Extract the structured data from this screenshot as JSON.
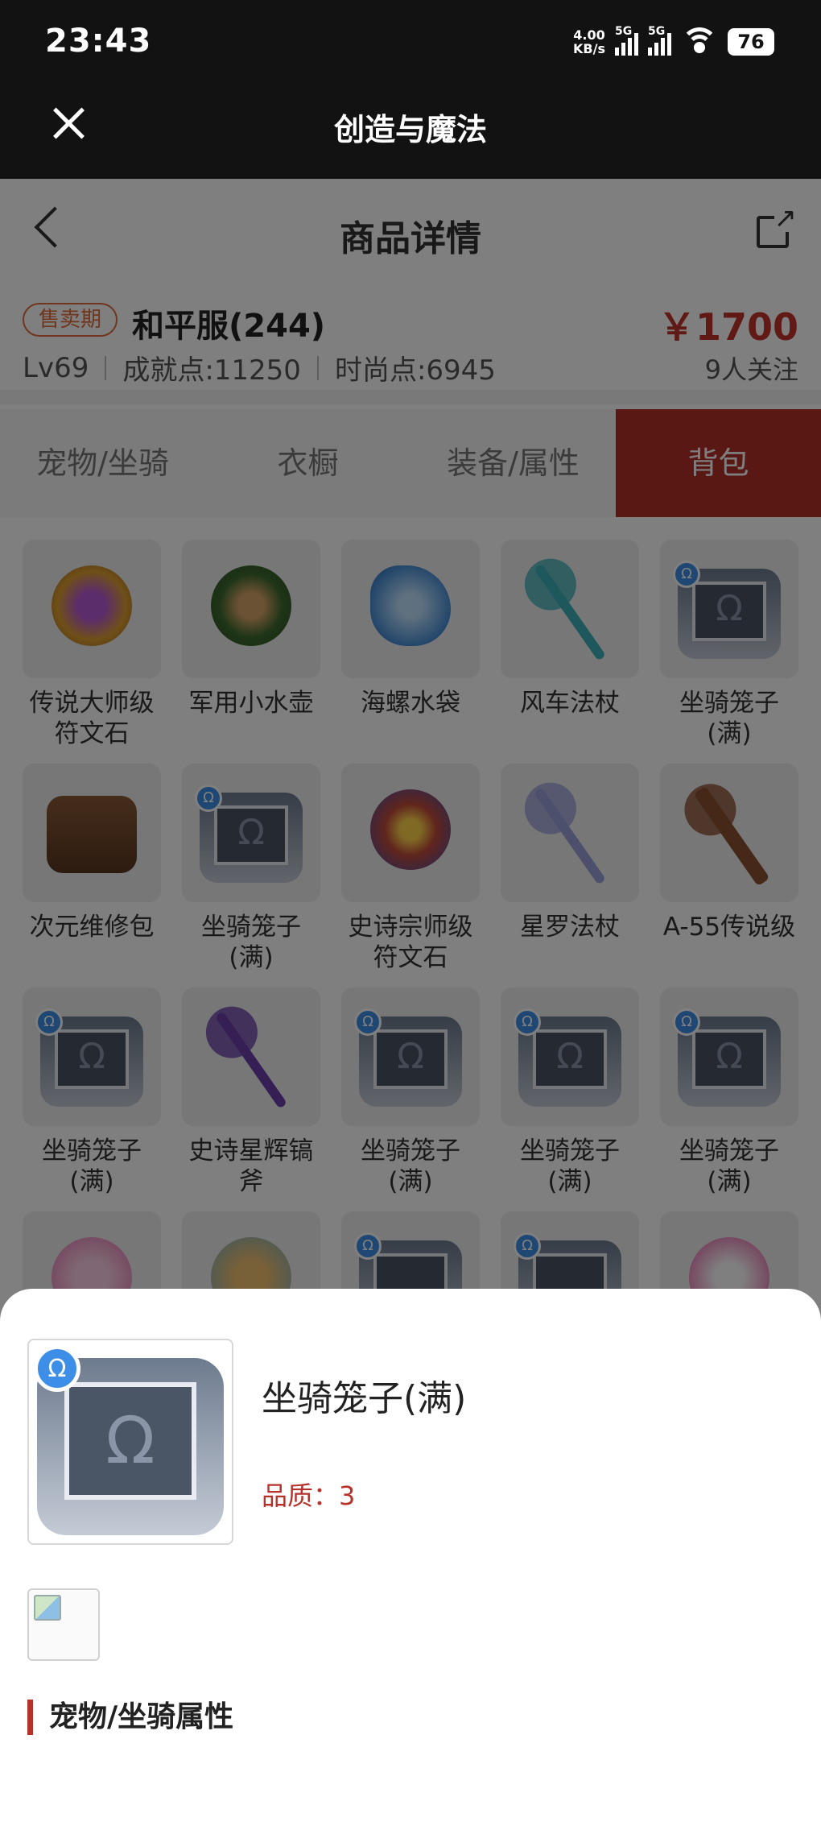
{
  "status_bar": {
    "time": "23:43",
    "speed_value": "4.00",
    "speed_unit": "KB/s",
    "signal1": "5G",
    "signal2": "5G",
    "battery": "76"
  },
  "app_bar": {
    "title": "创造与魔法"
  },
  "nav": {
    "title": "商品详情"
  },
  "listing": {
    "tag": "售卖期",
    "server": "和平服(244)",
    "price": "￥1700",
    "level": "Lv69",
    "achievement": "成就点:11250",
    "fashion": "时尚点:6945",
    "followers": "9人关注"
  },
  "tabs": [
    {
      "label": "宠物/坐骑"
    },
    {
      "label": "衣橱"
    },
    {
      "label": "装备/属性"
    },
    {
      "label": "背包",
      "active": true
    }
  ],
  "items": [
    {
      "name": "传说大师级符文石",
      "icon": "rune-stone-icon"
    },
    {
      "name": "军用小水壶",
      "icon": "canteen-icon"
    },
    {
      "name": "海螺水袋",
      "icon": "conch-icon"
    },
    {
      "name": "风车法杖",
      "icon": "pinwheel-staff-icon"
    },
    {
      "name": "坐骑笼子(满)",
      "icon": "mount-cage-icon"
    },
    {
      "name": "次元维修包",
      "icon": "repair-kit-icon"
    },
    {
      "name": "坐骑笼子(满)",
      "icon": "mount-cage-icon"
    },
    {
      "name": "史诗宗师级符文石",
      "icon": "rune-stone-icon"
    },
    {
      "name": "星罗法杖",
      "icon": "star-staff-icon"
    },
    {
      "name": "A-55传说级",
      "icon": "rifle-icon"
    },
    {
      "name": "坐骑笼子(满)",
      "icon": "mount-cage-icon"
    },
    {
      "name": "史诗星辉镐斧",
      "icon": "pickaxe-icon"
    },
    {
      "name": "坐骑笼子(满)",
      "icon": "mount-cage-icon"
    },
    {
      "name": "坐骑笼子(满)",
      "icon": "mount-cage-icon"
    },
    {
      "name": "坐骑笼子(满)",
      "icon": "mount-cage-icon"
    }
  ],
  "sheet": {
    "item_name": "坐骑笼子(满)",
    "quality": "品质：3",
    "section_title": "宠物/坐骑属性"
  },
  "colors": {
    "accent": "#b5312a",
    "price": "#c0322b",
    "tag": "#e06a3a"
  }
}
